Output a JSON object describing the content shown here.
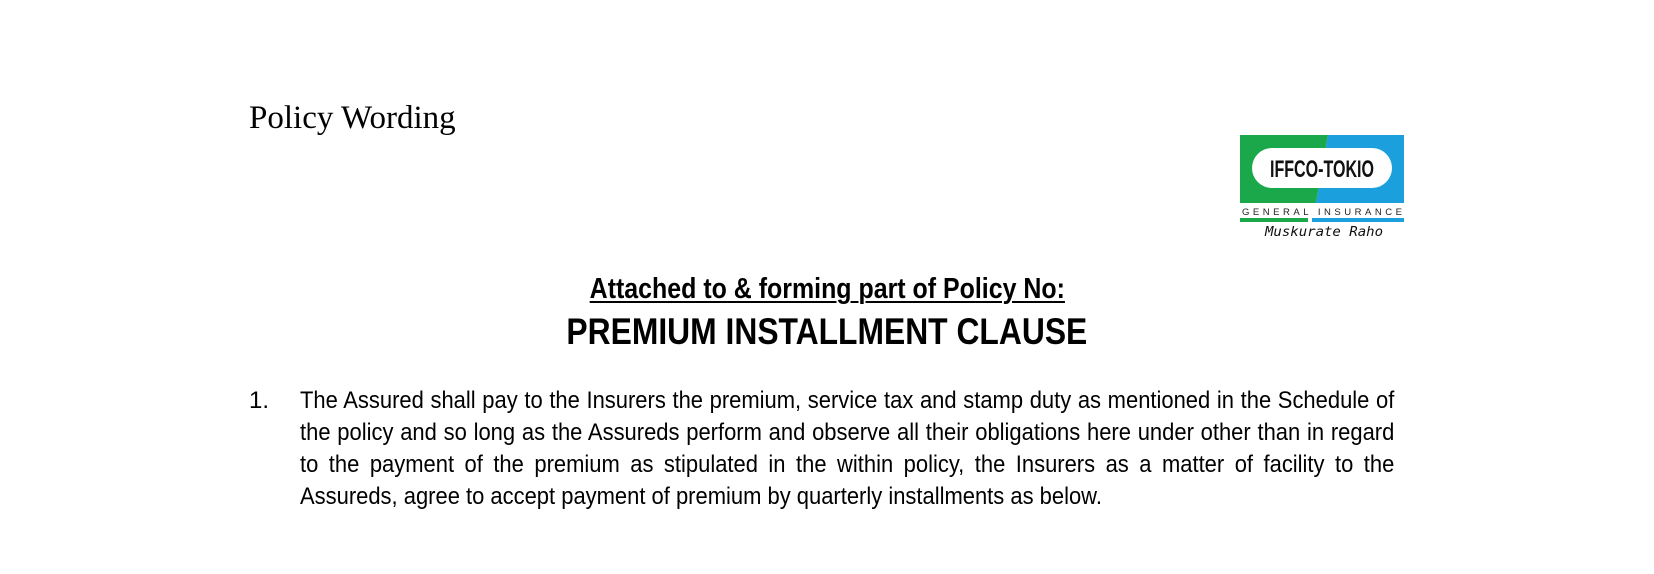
{
  "header": {
    "label": "Policy Wording"
  },
  "logo": {
    "brand": "IFFCO-TOKIO",
    "tagline": "GENERAL INSURANCE",
    "slogan": "Muskurate Raho",
    "colors": {
      "green": "#1aa84a",
      "blue": "#1ba0dd"
    }
  },
  "document": {
    "subtitle": "Attached to & forming part of Policy No:",
    "title": "PREMIUM INSTALLMENT CLAUSE",
    "clauses": [
      {
        "number": "1.",
        "text": "The Assured shall pay to the Insurers the premium, service tax and stamp duty as mentioned in the Schedule of the policy and so long as the Assureds perform and observe all their obligations here under other than in regard to the payment of the premium as stipulated in the within policy, the Insurers as a matter of facility to the Assureds, agree to accept payment of premium by quarterly installments as below."
      }
    ]
  }
}
